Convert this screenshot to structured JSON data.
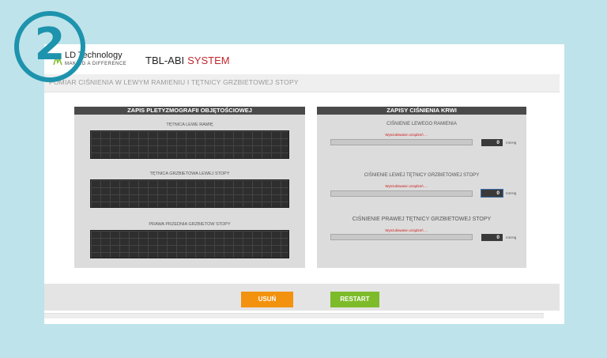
{
  "step": {
    "number": "2"
  },
  "logo": {
    "name": "LD Technology",
    "tagline": "MAKING A DIFFERENCE"
  },
  "app": {
    "title": "TBL-ABI",
    "title_accent": "SYSTEM",
    "accent_color": "#c0272d"
  },
  "subheader": {
    "text": "POMIAR CIŚNIENIA W LEWYM RAMIENIU I TĘTNICY GRZBIETOWEJ STOPY"
  },
  "pleth_panel": {
    "title": "ZAPIS PLETYZMOGRAFII OBJĘTOŚCIOWEJ",
    "channels": [
      {
        "label": "TĘTNICA LEWE RAMIĘ"
      },
      {
        "label": "TĘTNICA GRZBIETOWA LEWEJ STOPY"
      },
      {
        "label": "PRAWA PRZEDNIA GRZBIETOW STOPY"
      }
    ]
  },
  "bp_panel": {
    "title": "ZAPISY CIŚNIENIA KRWI",
    "measurements": [
      {
        "label": "CIŚNIENIE LEWEGO RAMIENIA",
        "status": "Wyszukiwanie urządzeń ...",
        "value": "0",
        "unit": "mmHg",
        "progress": 0
      },
      {
        "label": "CIŚNIENIE LEWEJ TĘTNICY GRZBIETOWEJ STOPY",
        "status": "Wyszukiwanie urządzeń ...",
        "value": "0",
        "unit": "mmHg",
        "progress": 0
      },
      {
        "label": "CIŚNIENIE PRAWEJ TĘTNICY GRZBIETOWEJ STOPY",
        "status": "Wyszukiwanie urządzeń ...",
        "value": "0",
        "unit": "mmHg",
        "progress": 0
      }
    ]
  },
  "footer": {
    "delete_label": "USUŃ",
    "restart_label": "RESTART",
    "delete_color": "#f2920f",
    "restart_color": "#7dbb2a"
  }
}
